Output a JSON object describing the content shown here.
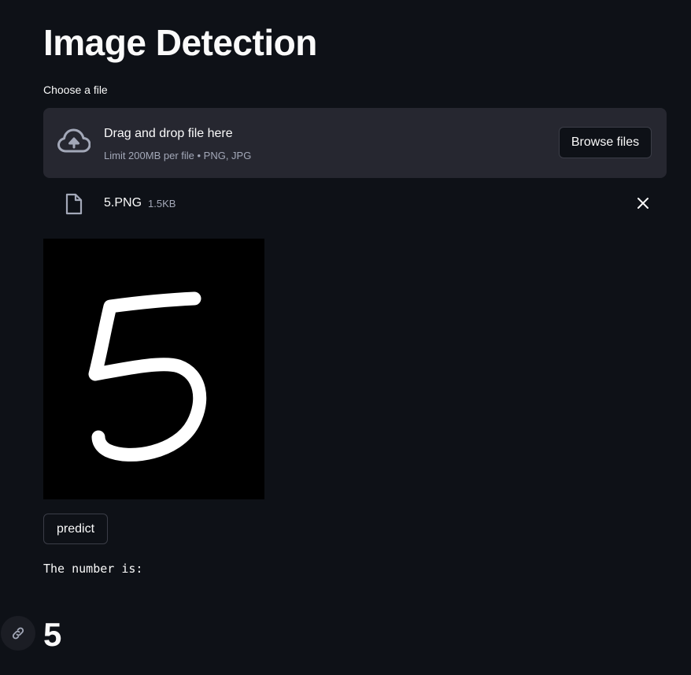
{
  "page": {
    "title": "Image Detection"
  },
  "uploader": {
    "label": "Choose a file",
    "drag_text": "Drag and drop file here",
    "limit_text": "Limit 200MB per file • PNG, JPG",
    "browse_label": "Browse files",
    "icon": "cloud-upload-icon"
  },
  "uploaded_file": {
    "name": "5.PNG",
    "size": "1.5KB",
    "icon": "file-icon",
    "remove_icon": "close-icon"
  },
  "image": {
    "depicted_digit": "5"
  },
  "actions": {
    "predict_label": "predict"
  },
  "result": {
    "label": "The number is:",
    "value": "5",
    "anchor_icon": "link-icon"
  },
  "colors": {
    "background": "#0e1117",
    "surface": "#262730",
    "text": "#fafafa",
    "muted_text": "#a3a8b8",
    "border": "#3b3d47"
  }
}
